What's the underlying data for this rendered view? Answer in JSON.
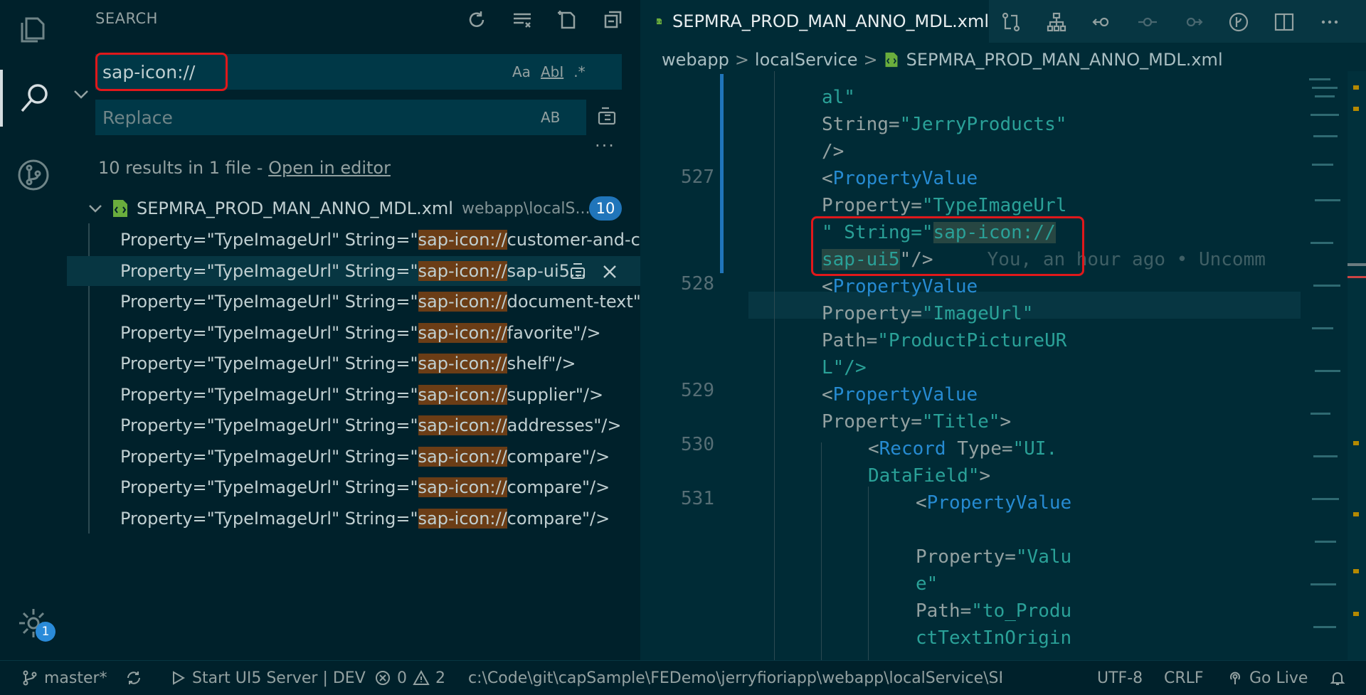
{
  "activity_bar": {
    "icons": [
      "explorer-icon",
      "search-icon",
      "source-control-icon",
      "manage-gear-icon"
    ],
    "manage_badge": "1"
  },
  "sidebar": {
    "title": "SEARCH",
    "search": {
      "value": "sap-icon://",
      "options": [
        "Aa",
        "AbI",
        ".*"
      ]
    },
    "replace": {
      "placeholder": "Replace",
      "option": "AB"
    },
    "more": "...",
    "summary": {
      "text": "10 results in 1 file - ",
      "link": "Open in editor"
    },
    "file": {
      "name": "SEPMRA_PROD_MAN_ANNO_MDL.xml",
      "path": "webapp\\localS...",
      "count": "10"
    },
    "matches": [
      {
        "prefix": "Property=\"TypeImageUrl\" String=\"",
        "hit": "sap-icon://",
        "suffix": "customer-and-c..."
      },
      {
        "prefix": "Property=\"TypeImageUrl\" String=\"",
        "hit": "sap-icon://",
        "suffix": "sap-ui5..."
      },
      {
        "prefix": "Property=\"TypeImageUrl\" String=\"",
        "hit": "sap-icon://",
        "suffix": "document-text\"/>"
      },
      {
        "prefix": "Property=\"TypeImageUrl\" String=\"",
        "hit": "sap-icon://",
        "suffix": "favorite\"/>"
      },
      {
        "prefix": "Property=\"TypeImageUrl\" String=\"",
        "hit": "sap-icon://",
        "suffix": "shelf\"/>"
      },
      {
        "prefix": "Property=\"TypeImageUrl\" String=\"",
        "hit": "sap-icon://",
        "suffix": "supplier\"/>"
      },
      {
        "prefix": "Property=\"TypeImageUrl\" String=\"",
        "hit": "sap-icon://",
        "suffix": "addresses\"/>"
      },
      {
        "prefix": "Property=\"TypeImageUrl\" String=\"",
        "hit": "sap-icon://",
        "suffix": "compare\"/>"
      },
      {
        "prefix": "Property=\"TypeImageUrl\" String=\"",
        "hit": "sap-icon://",
        "suffix": "compare\"/>"
      },
      {
        "prefix": "Property=\"TypeImageUrl\" String=\"",
        "hit": "sap-icon://",
        "suffix": "compare\"/>"
      }
    ]
  },
  "editor": {
    "tab": "SEPMRA_PROD_MAN_ANNO_MDL.xml",
    "breadcrumb": [
      "webapp",
      "localService",
      "SEPMRA_PROD_MAN_ANNO_MDL.xml"
    ],
    "line_numbers": [
      "527",
      "528",
      "529",
      "530",
      "531"
    ],
    "lines": {
      "l0": "al\"",
      "l1a": "String=",
      "l1b": "\"JerryProducts\"",
      "l2": "/>",
      "l3a": "<",
      "l3b": "PropertyValue",
      "l4a": "Property=",
      "l4b": "\"TypeImageUrl",
      "l5a": "\" String=",
      "l5b": "\"",
      "l5c": "sap-icon://",
      "l6a": "sap-ui5",
      "l6b": "\"/>",
      "blame": "You, an hour ago • Uncomm",
      "l7a": "<",
      "l7b": "PropertyValue",
      "l8a": "Property=",
      "l8b": "\"ImageUrl\"",
      "l9a": "Path=",
      "l9b": "\"ProductPictureUR",
      "l10a": "L\"/>",
      "l11a": "<",
      "l11b": "PropertyValue",
      "l12a": "Property=",
      "l12b": "\"Title\"",
      "l12c": ">",
      "l13a": "<",
      "l13b": "Record",
      "l13c": " Type=",
      "l13d": "\"UI.",
      "l14a": "DataField\"",
      "l14b": ">",
      "l15a": "<",
      "l15b": "PropertyValue",
      "l16a": "Property=",
      "l16b": "\"Valu",
      "l17a": "e\"",
      "l18a": "Path=",
      "l18b": "\"to_Produ",
      "l19a": "ctTextInOrigin"
    }
  },
  "status_bar": {
    "branch": "master*",
    "run": "Start UI5 Server | DEV",
    "errors": "0",
    "warnings": "2",
    "path": "c:\\Code\\git\\capSample\\FEDemo\\jerryfioriapp\\webapp\\localService\\SEI",
    "encoding": "UTF-8",
    "eol": "CRLF",
    "golive": "Go Live"
  }
}
